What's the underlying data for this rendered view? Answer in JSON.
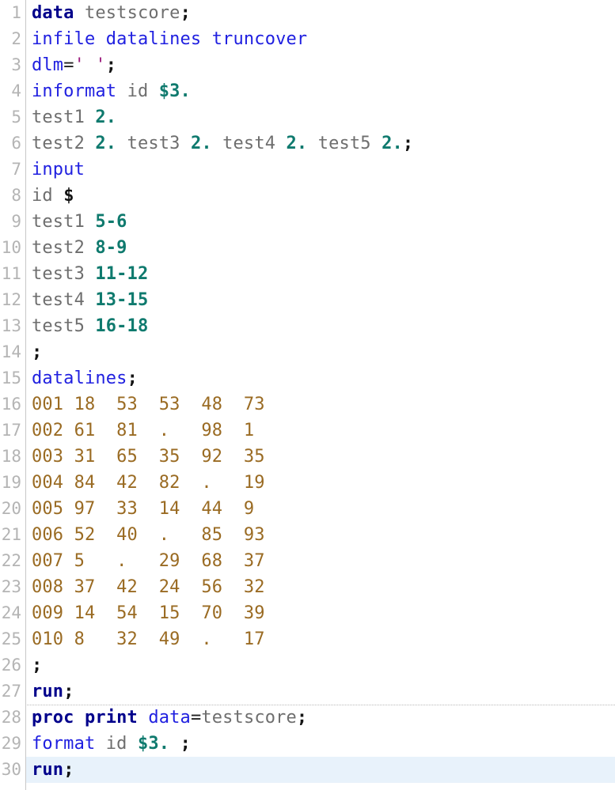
{
  "editor": {
    "language": "SAS",
    "highlighted_line": 30,
    "separator_above_line": 28,
    "total_lines": 30,
    "colors": {
      "background": "#ffffff",
      "gutter_text": "#b4b4b4",
      "gutter_divider": "#c8c8c8",
      "current_line_highlight": "#e8f2fb",
      "statement_keyword": "#00008b",
      "keyword": "#2020e0",
      "identifier": "#6e6e6e",
      "informat": "#0f7a6e",
      "string": "#9b1b7c",
      "punctuation": "#141414",
      "datalines": "#9a6b23",
      "separator": "#b9b9b9"
    }
  },
  "lines": [
    {
      "number": "1",
      "tokens": [
        {
          "text": "data",
          "cls": "t-stmt"
        },
        {
          "text": " ",
          "cls": "t-ident"
        },
        {
          "text": "testscore",
          "cls": "t-ident"
        },
        {
          "text": ";",
          "cls": "t-punct"
        }
      ]
    },
    {
      "number": "2",
      "tokens": [
        {
          "text": "infile datalines truncover",
          "cls": "t-kw"
        }
      ]
    },
    {
      "number": "3",
      "tokens": [
        {
          "text": "dlm",
          "cls": "t-kw"
        },
        {
          "text": "=",
          "cls": "t-op"
        },
        {
          "text": "' '",
          "cls": "t-str"
        },
        {
          "text": ";",
          "cls": "t-punct"
        }
      ]
    },
    {
      "number": "4",
      "tokens": [
        {
          "text": "informat",
          "cls": "t-kw"
        },
        {
          "text": " id ",
          "cls": "t-ident"
        },
        {
          "text": "$3.",
          "cls": "t-fmt"
        }
      ]
    },
    {
      "number": "5",
      "tokens": [
        {
          "text": "test1 ",
          "cls": "t-ident"
        },
        {
          "text": "2.",
          "cls": "t-fmt"
        }
      ]
    },
    {
      "number": "6",
      "tokens": [
        {
          "text": "test2 ",
          "cls": "t-ident"
        },
        {
          "text": "2.",
          "cls": "t-fmt"
        },
        {
          "text": " test3 ",
          "cls": "t-ident"
        },
        {
          "text": "2.",
          "cls": "t-fmt"
        },
        {
          "text": " test4 ",
          "cls": "t-ident"
        },
        {
          "text": "2.",
          "cls": "t-fmt"
        },
        {
          "text": " test5 ",
          "cls": "t-ident"
        },
        {
          "text": "2.",
          "cls": "t-fmt"
        },
        {
          "text": ";",
          "cls": "t-punct"
        }
      ]
    },
    {
      "number": "7",
      "tokens": [
        {
          "text": "input",
          "cls": "t-kw"
        }
      ]
    },
    {
      "number": "8",
      "tokens": [
        {
          "text": "id ",
          "cls": "t-ident"
        },
        {
          "text": "$",
          "cls": "t-punct"
        }
      ]
    },
    {
      "number": "9",
      "tokens": [
        {
          "text": "test1 ",
          "cls": "t-ident"
        },
        {
          "text": "5-6",
          "cls": "t-fmt"
        }
      ]
    },
    {
      "number": "10",
      "tokens": [
        {
          "text": "test2 ",
          "cls": "t-ident"
        },
        {
          "text": "8-9",
          "cls": "t-fmt"
        }
      ]
    },
    {
      "number": "11",
      "tokens": [
        {
          "text": "test3 ",
          "cls": "t-ident"
        },
        {
          "text": "11-12",
          "cls": "t-fmt"
        }
      ]
    },
    {
      "number": "12",
      "tokens": [
        {
          "text": "test4 ",
          "cls": "t-ident"
        },
        {
          "text": "13-15",
          "cls": "t-fmt"
        }
      ]
    },
    {
      "number": "13",
      "tokens": [
        {
          "text": "test5 ",
          "cls": "t-ident"
        },
        {
          "text": "16-18",
          "cls": "t-fmt"
        }
      ]
    },
    {
      "number": "14",
      "tokens": [
        {
          "text": ";",
          "cls": "t-punct"
        }
      ]
    },
    {
      "number": "15",
      "tokens": [
        {
          "text": "datalines",
          "cls": "t-kw"
        },
        {
          "text": ";",
          "cls": "t-punct"
        }
      ]
    },
    {
      "number": "16",
      "tokens": [
        {
          "text": "001 18  53  53  48  73",
          "cls": "t-data"
        }
      ]
    },
    {
      "number": "17",
      "tokens": [
        {
          "text": "002 61  81  .   98  1",
          "cls": "t-data"
        }
      ]
    },
    {
      "number": "18",
      "tokens": [
        {
          "text": "003 31  65  35  92  35",
          "cls": "t-data"
        }
      ]
    },
    {
      "number": "19",
      "tokens": [
        {
          "text": "004 84  42  82  .   19",
          "cls": "t-data"
        }
      ]
    },
    {
      "number": "20",
      "tokens": [
        {
          "text": "005 97  33  14  44  9",
          "cls": "t-data"
        }
      ]
    },
    {
      "number": "21",
      "tokens": [
        {
          "text": "006 52  40  .   85  93",
          "cls": "t-data"
        }
      ]
    },
    {
      "number": "22",
      "tokens": [
        {
          "text": "007 5   .   29  68  37",
          "cls": "t-data"
        }
      ]
    },
    {
      "number": "23",
      "tokens": [
        {
          "text": "008 37  42  24  56  32",
          "cls": "t-data"
        }
      ]
    },
    {
      "number": "24",
      "tokens": [
        {
          "text": "009 14  54  15  70  39",
          "cls": "t-data"
        }
      ]
    },
    {
      "number": "25",
      "tokens": [
        {
          "text": "010 8   32  49  .   17",
          "cls": "t-data"
        }
      ]
    },
    {
      "number": "26",
      "tokens": [
        {
          "text": ";",
          "cls": "t-punct"
        }
      ]
    },
    {
      "number": "27",
      "tokens": [
        {
          "text": "run",
          "cls": "t-stmt"
        },
        {
          "text": ";",
          "cls": "t-punct"
        }
      ]
    },
    {
      "number": "28",
      "separator": true,
      "tokens": [
        {
          "text": "proc print",
          "cls": "t-stmt"
        },
        {
          "text": " ",
          "cls": "t-ident"
        },
        {
          "text": "data",
          "cls": "t-kw"
        },
        {
          "text": "=",
          "cls": "t-op"
        },
        {
          "text": "testscore",
          "cls": "t-ident"
        },
        {
          "text": ";",
          "cls": "t-punct"
        }
      ]
    },
    {
      "number": "29",
      "tokens": [
        {
          "text": "format",
          "cls": "t-kw"
        },
        {
          "text": " id ",
          "cls": "t-ident"
        },
        {
          "text": "$3.",
          "cls": "t-fmt"
        },
        {
          "text": " ",
          "cls": "t-ident"
        },
        {
          "text": ";",
          "cls": "t-punct"
        }
      ]
    },
    {
      "number": "30",
      "highlight": true,
      "tokens": [
        {
          "text": "run",
          "cls": "t-stmt"
        },
        {
          "text": ";",
          "cls": "t-punct"
        }
      ]
    }
  ]
}
